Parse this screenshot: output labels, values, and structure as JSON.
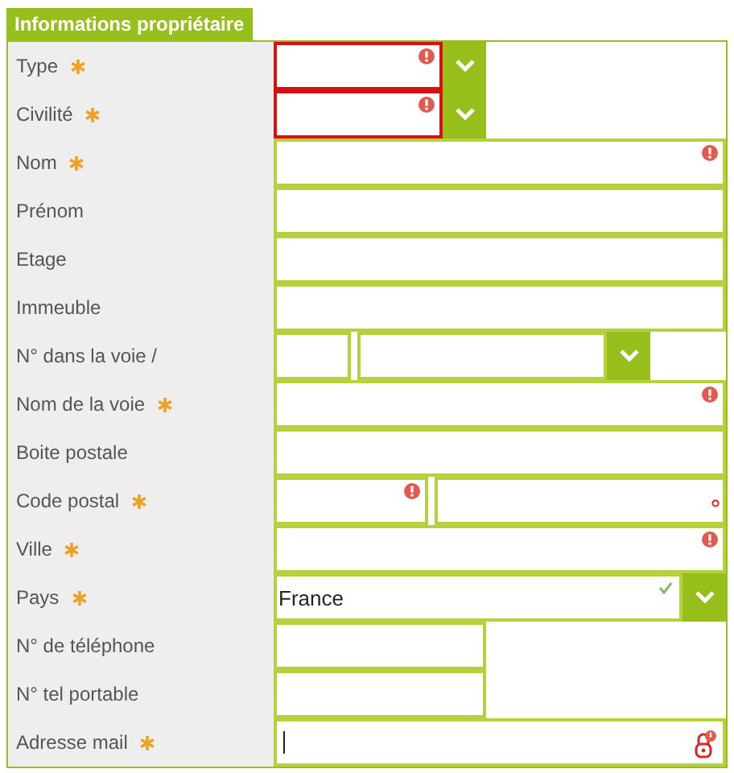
{
  "section": {
    "title": "Informations propriétaire"
  },
  "rows": [
    {
      "label": "Type",
      "required": true,
      "fields": [
        {
          "kind": "select",
          "invalid": true,
          "error": true
        }
      ]
    },
    {
      "label": "Civilité",
      "required": true,
      "fields": [
        {
          "kind": "select",
          "invalid": true,
          "error": true
        }
      ]
    },
    {
      "label": "Nom",
      "required": true,
      "fields": [
        {
          "kind": "text",
          "error": true
        }
      ]
    },
    {
      "label": "Prénom",
      "required": false,
      "fields": [
        {
          "kind": "text",
          "error": false
        }
      ]
    },
    {
      "label": "Etage",
      "required": false,
      "fields": [
        {
          "kind": "text",
          "error": false
        }
      ]
    },
    {
      "label": "Immeuble",
      "required": false,
      "fields": [
        {
          "kind": "text",
          "error": false
        }
      ]
    },
    {
      "label": "N° dans la voie /",
      "required": false,
      "fields": [
        {
          "kind": "number_text",
          "error": false
        },
        {
          "kind": "wide_select",
          "error": false
        }
      ]
    },
    {
      "label": "Nom de la voie",
      "required": true,
      "fields": [
        {
          "kind": "text",
          "error": true
        }
      ]
    },
    {
      "label": "Boite postale",
      "required": false,
      "fields": [
        {
          "kind": "text",
          "error": false
        }
      ]
    },
    {
      "label": "Code postal",
      "required": true,
      "fields": [
        {
          "kind": "code_text",
          "error": true
        },
        {
          "kind": "text",
          "error": false,
          "dot": true
        }
      ]
    },
    {
      "label": "Ville",
      "required": true,
      "fields": [
        {
          "kind": "text",
          "error": true
        }
      ]
    },
    {
      "label": "Pays",
      "required": true,
      "fields": [
        {
          "kind": "full_select",
          "error": false,
          "valid": true,
          "value": "France"
        }
      ]
    },
    {
      "label": "N° de téléphone",
      "required": false,
      "fields": [
        {
          "kind": "short_text",
          "error": false
        }
      ]
    },
    {
      "label": "N° tel portable",
      "required": false,
      "fields": [
        {
          "kind": "short_text",
          "error": false
        }
      ]
    },
    {
      "label": "Adresse mail",
      "required": true,
      "fields": [
        {
          "kind": "text",
          "error": false,
          "focused": true,
          "lock": true
        }
      ]
    }
  ]
}
